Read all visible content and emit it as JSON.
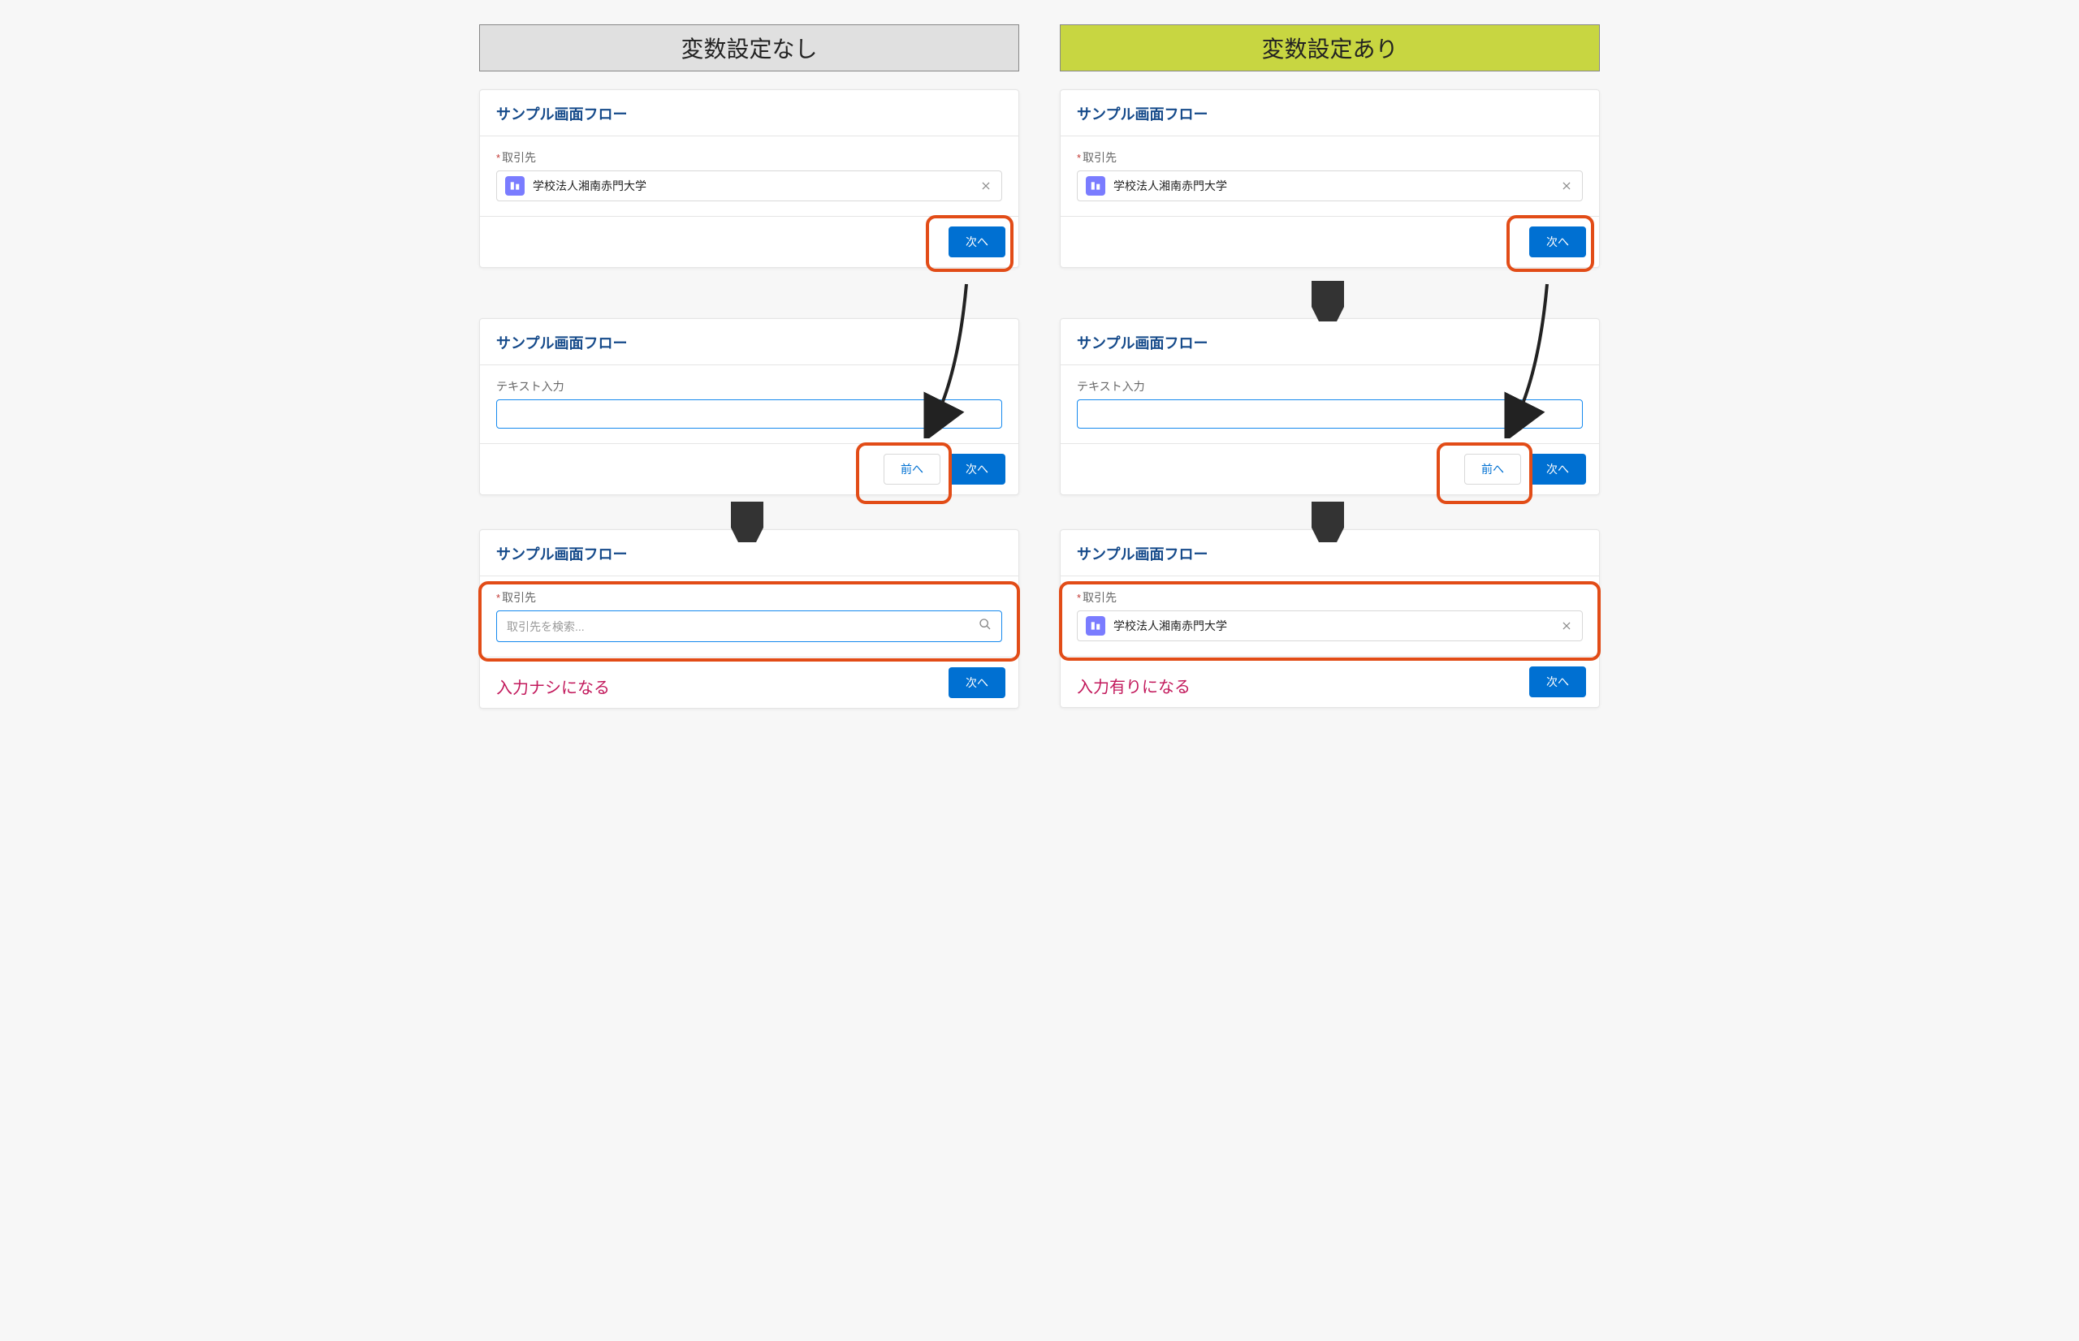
{
  "headers": {
    "without": "変数設定なし",
    "with": "変数設定あり"
  },
  "flow_title": "サンプル画面フロー",
  "labels": {
    "account": "取引先",
    "text_input": "テキスト入力",
    "search_placeholder": "取引先を検索..."
  },
  "account_value": "学校法人湘南赤門大学",
  "buttons": {
    "next": "次へ",
    "prev": "前へ"
  },
  "notes": {
    "empty": "入力ナシになる",
    "filled": "入力有りになる"
  }
}
